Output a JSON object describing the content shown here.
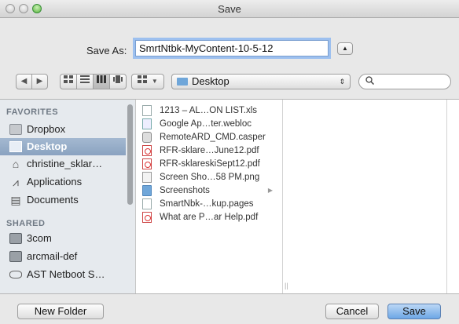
{
  "window": {
    "title": "Save"
  },
  "save_as": {
    "label": "Save As:",
    "value": "SmrtNtbk-MyContent-10-5-12",
    "expand_glyph": "▲"
  },
  "toolbar": {
    "back_glyph": "◀",
    "forward_glyph": "▶",
    "location": "Desktop",
    "location_arrows": "⇕",
    "search_glyph": "🔍"
  },
  "sidebar": {
    "favorites_heading": "FAVORITES",
    "favorites": [
      {
        "label": "Dropbox",
        "icon": "folder-icon"
      },
      {
        "label": "Desktop",
        "icon": "desktop-icon",
        "selected": true
      },
      {
        "label": "christine_sklar…",
        "icon": "home-icon"
      },
      {
        "label": "Applications",
        "icon": "applications-icon"
      },
      {
        "label": "Documents",
        "icon": "documents-icon"
      }
    ],
    "shared_heading": "SHARED",
    "shared": [
      {
        "label": "3com",
        "icon": "monitor-icon"
      },
      {
        "label": "arcmail-def",
        "icon": "monitor-icon"
      },
      {
        "label": "AST Netboot S…",
        "icon": "disk-icon"
      }
    ]
  },
  "files": [
    {
      "name": "1213 – AL…ON LIST.xls",
      "icon": "document-icon"
    },
    {
      "name": "Google Ap…ter.webloc",
      "icon": "webloc-icon"
    },
    {
      "name": "RemoteARD_CMD.casper",
      "icon": "app-icon"
    },
    {
      "name": "RFR-sklare…June12.pdf",
      "icon": "pdf-icon"
    },
    {
      "name": "RFR-sklareskiSept12.pdf",
      "icon": "pdf-icon"
    },
    {
      "name": "Screen Sho…58 PM.png",
      "icon": "image-icon"
    },
    {
      "name": "Screenshots",
      "icon": "folder-icon",
      "is_folder": true
    },
    {
      "name": "SmartNbk-…kup.pages",
      "icon": "document-icon"
    },
    {
      "name": "What are P…ar Help.pdf",
      "icon": "pdf-icon"
    }
  ],
  "buttons": {
    "new_folder": "New Folder",
    "cancel": "Cancel",
    "save": "Save"
  },
  "colors": {
    "selection": "#8aa2c0",
    "default_button": "#6da7e6",
    "focus_ring": "#9dc0ef"
  }
}
